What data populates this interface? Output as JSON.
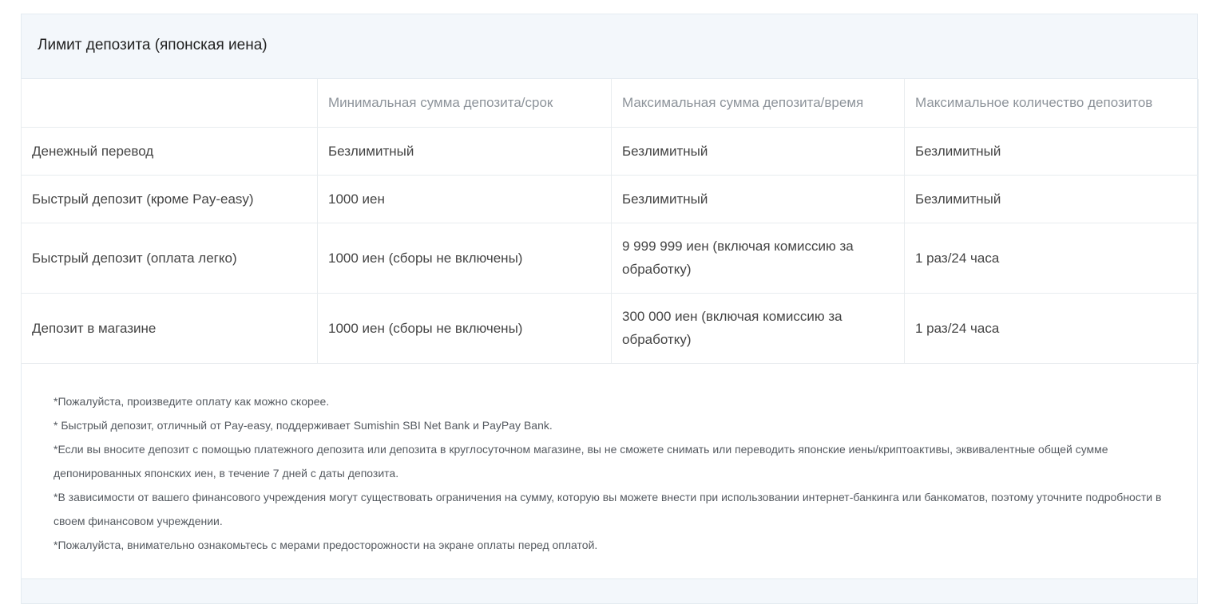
{
  "card": {
    "title": "Лимит депозита (японская иена)"
  },
  "table": {
    "headers": [
      "",
      "Минимальная сумма депозита/срок",
      "Максимальная сумма депозита/время",
      "Максимальное количество депозитов"
    ],
    "rows": [
      {
        "method": "Денежный перевод",
        "min": "Безлимитный",
        "max": "Безлимитный",
        "count": "Безлимитный"
      },
      {
        "method": "Быстрый депозит (кроме Pay-easy)",
        "min": "1000 иен",
        "max": "Безлимитный",
        "count": "Безлимитный"
      },
      {
        "method": "Быстрый депозит (оплата легко)",
        "min": "1000 иен (сборы не включены)",
        "max": "9 999 999 иен (включая комиссию за обработку)",
        "count": "1 раз/24 часа"
      },
      {
        "method": "Депозит в магазине",
        "min": "1000 иен (сборы не включены)",
        "max": "300 000 иен (включая комиссию за обработку)",
        "count": "1 раз/24 часа"
      }
    ]
  },
  "notes": [
    "*Пожалуйста, произведите оплату как можно скорее.",
    "* Быстрый депозит, отличный от Pay-easy, поддерживает Sumishin SBI Net Bank и PayPay Bank.",
    "*Если вы вносите депозит с помощью платежного депозита или депозита в круглосуточном магазине, вы не сможете снимать или переводить японские иены/криптоактивы, эквивалентные общей сумме депонированных японских иен, в течение 7 дней с даты депозита.",
    "*В зависимости от вашего финансового учреждения могут существовать ограничения на сумму, которую вы можете внести при использовании интернет-банкинга или банкоматов, поэтому уточните подробности в своем финансовом учреждении.",
    "*Пожалуйста, внимательно ознакомьтесь с мерами предосторожности на экране оплаты перед оплатой."
  ],
  "colors": {
    "header_bg": "#f3f7fb",
    "border": "#e4ebf1",
    "header_text": "#8d939a",
    "body_text": "#444444"
  }
}
